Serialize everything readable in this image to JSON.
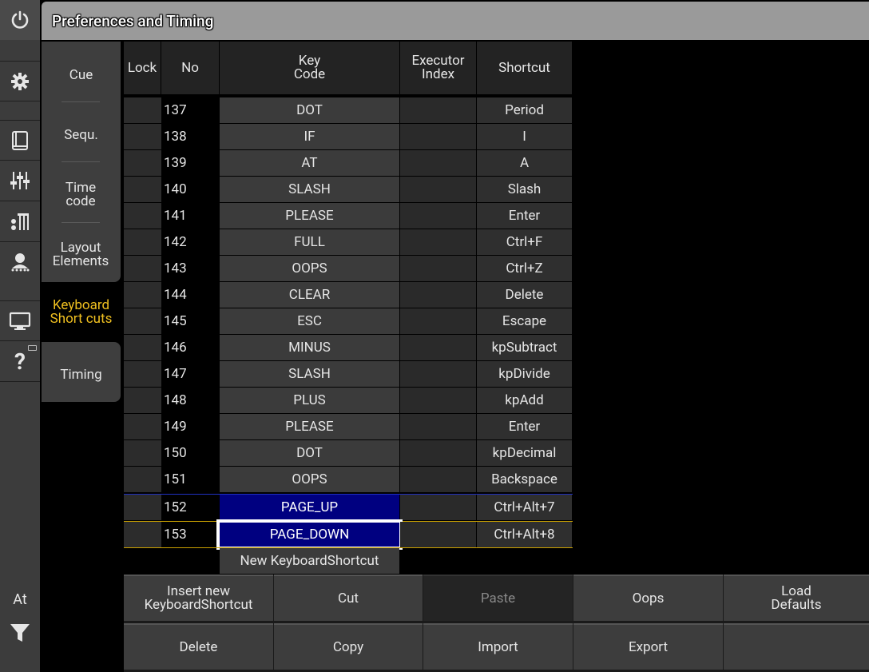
{
  "window": {
    "title": "Preferences and Timing"
  },
  "rail": {
    "at_label": "At"
  },
  "tabs": [
    {
      "label": "Cue",
      "active": false
    },
    {
      "label": "Sequ.",
      "active": false
    },
    {
      "label": "Time code",
      "active": false
    },
    {
      "label": "Layout Elements",
      "active": false
    },
    {
      "label": "Keyboard Short cuts",
      "active": true
    },
    {
      "label": "Timing",
      "active": false
    }
  ],
  "columns": {
    "lock": "Lock",
    "no": "No",
    "key": "Key Code",
    "exec": "Executor Index",
    "shortcut": "Shortcut"
  },
  "rows": [
    {
      "no": "137",
      "key": "DOT",
      "exec": "",
      "shortcut": "Period"
    },
    {
      "no": "138",
      "key": "IF",
      "exec": "",
      "shortcut": "I"
    },
    {
      "no": "139",
      "key": "AT",
      "exec": "",
      "shortcut": "A"
    },
    {
      "no": "140",
      "key": "SLASH",
      "exec": "",
      "shortcut": "Slash"
    },
    {
      "no": "141",
      "key": "PLEASE",
      "exec": "",
      "shortcut": "Enter"
    },
    {
      "no": "142",
      "key": "FULL",
      "exec": "",
      "shortcut": "Ctrl+F"
    },
    {
      "no": "143",
      "key": "OOPS",
      "exec": "",
      "shortcut": "Ctrl+Z"
    },
    {
      "no": "144",
      "key": "CLEAR",
      "exec": "",
      "shortcut": "Delete"
    },
    {
      "no": "145",
      "key": "ESC",
      "exec": "",
      "shortcut": "Escape"
    },
    {
      "no": "146",
      "key": "MINUS",
      "exec": "",
      "shortcut": "kpSubtract"
    },
    {
      "no": "147",
      "key": "SLASH",
      "exec": "",
      "shortcut": "kpDivide"
    },
    {
      "no": "148",
      "key": "PLUS",
      "exec": "",
      "shortcut": "kpAdd"
    },
    {
      "no": "149",
      "key": "PLEASE",
      "exec": "",
      "shortcut": "Enter"
    },
    {
      "no": "150",
      "key": "DOT",
      "exec": "",
      "shortcut": "kpDecimal"
    },
    {
      "no": "151",
      "key": "OOPS",
      "exec": "",
      "shortcut": "Backspace"
    },
    {
      "no": "152",
      "key": "PAGE_UP",
      "exec": "",
      "shortcut": "Ctrl+Alt+7"
    },
    {
      "no": "153",
      "key": "PAGE_DOWN",
      "exec": "",
      "shortcut": "Ctrl+Alt+8"
    }
  ],
  "new_row_label": "New KeyboardShortcut",
  "buttons": {
    "insert": "Insert new KeyboardShortcut",
    "cut": "Cut",
    "paste": "Paste",
    "oops": "Oops",
    "load_defaults": "Load Defaults",
    "delete": "Delete",
    "copy": "Copy",
    "import": "Import",
    "export": "Export"
  },
  "colors": {
    "selection": "#000080",
    "active_tab": "#f0c020",
    "focus_outline": "#ffffff"
  }
}
